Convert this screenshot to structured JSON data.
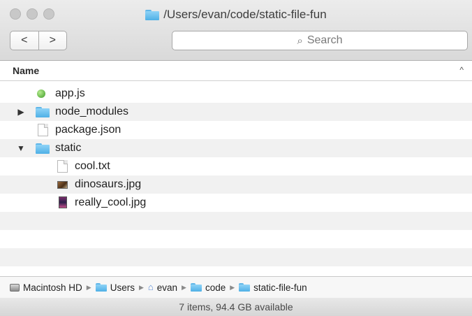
{
  "window": {
    "title": "/Users/evan/code/static-file-fun",
    "title_icon": "folder-icon"
  },
  "toolbar": {
    "back_glyph": "<",
    "forward_glyph": ">",
    "search_icon": "magnifier",
    "search_placeholder": "Search"
  },
  "columns": {
    "name_header": "Name",
    "sort_glyph": "^"
  },
  "rows": [
    {
      "label": "app.js",
      "icon": "js-file-icon",
      "disclosure": "",
      "indent": 0
    },
    {
      "label": "node_modules",
      "icon": "folder-icon",
      "disclosure": "▶",
      "indent": 0
    },
    {
      "label": "package.json",
      "icon": "document-icon",
      "disclosure": "",
      "indent": 0
    },
    {
      "label": "static",
      "icon": "folder-icon",
      "disclosure": "▼",
      "indent": 0
    },
    {
      "label": "cool.txt",
      "icon": "document-icon",
      "disclosure": "",
      "indent": 1
    },
    {
      "label": "dinosaurs.jpg",
      "icon": "image-icon",
      "disclosure": "",
      "indent": 1
    },
    {
      "label": "really_cool.jpg",
      "icon": "image-icon",
      "disclosure": "",
      "indent": 1
    }
  ],
  "pathbar": {
    "items": [
      "Macintosh HD",
      "Users",
      "evan",
      "code",
      "static-file-fun"
    ],
    "separator": "▶"
  },
  "status": {
    "text": "7 items, 94.4 GB available"
  }
}
